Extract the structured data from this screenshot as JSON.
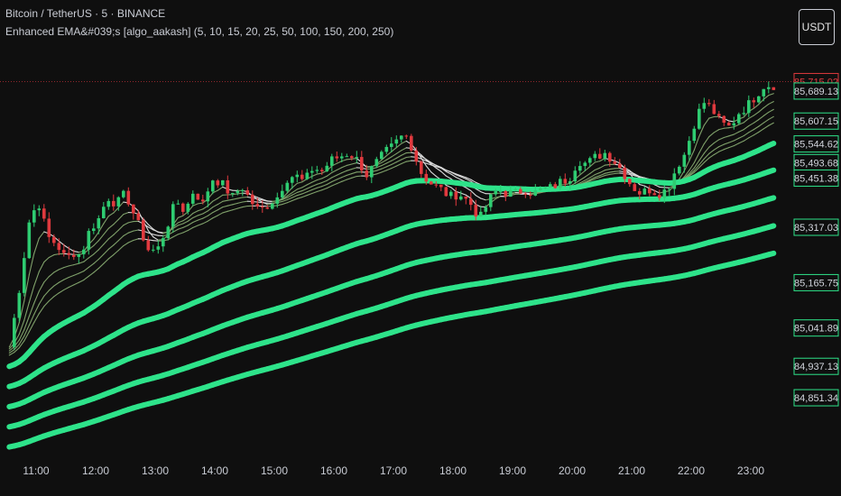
{
  "header": {
    "symbol": "Bitcoin / TetherUS · 5 · BINANCE",
    "indicator": "Enhanced EMA&#039;s [algo_aakash] (5, 10, 15, 20, 25, 50, 100, 150, 200, 250)"
  },
  "unit_button": "USDT",
  "colors": {
    "background": "#0f0f0f",
    "up": "#2ecc71",
    "down": "#e0393e",
    "ema_long": "#2ee38a",
    "ema_short": "#7fa06a",
    "ema_short_bearish": "#d9d9d9",
    "last_price": "#e0393e",
    "price_tag": "#2ee38a"
  },
  "chart_data": {
    "type": "candlestick",
    "x_labels": [
      "11:00",
      "12:00",
      "13:00",
      "14:00",
      "15:00",
      "16:00",
      "17:00",
      "18:00",
      "19:00",
      "20:00",
      "21:00",
      "22:00",
      "23:00"
    ],
    "ylim": [
      84780,
      85790
    ],
    "last_price": {
      "label": "85,715.02",
      "value": 85715.02
    },
    "price_tags": [
      {
        "label": "85,689.13",
        "value": 85689.13
      },
      {
        "label": "85,607.15",
        "value": 85607.15
      },
      {
        "label": "85,544.62",
        "value": 85544.62
      },
      {
        "label": "85,493.68",
        "value": 85493.68
      },
      {
        "label": "85,451.38",
        "value": 85451.38
      },
      {
        "label": "85,317.03",
        "value": 85317.03
      },
      {
        "label": "85,165.75",
        "value": 85165.75
      },
      {
        "label": "85,041.89",
        "value": 85041.89
      },
      {
        "label": "84,937.13",
        "value": 84937.13
      },
      {
        "label": "84,851.34",
        "value": 84851.34
      }
    ],
    "close_path": [
      [
        10.55,
        84990
      ],
      [
        10.7,
        85130
      ],
      [
        10.9,
        85350
      ],
      [
        11.05,
        85380
      ],
      [
        11.2,
        85290
      ],
      [
        11.35,
        85270
      ],
      [
        11.5,
        85230
      ],
      [
        11.65,
        85250
      ],
      [
        11.75,
        85240
      ],
      [
        11.9,
        85310
      ],
      [
        12.05,
        85340
      ],
      [
        12.2,
        85400
      ],
      [
        12.35,
        85380
      ],
      [
        12.5,
        85410
      ],
      [
        12.7,
        85330
      ],
      [
        12.9,
        85250
      ],
      [
        13.05,
        85260
      ],
      [
        13.2,
        85320
      ],
      [
        13.35,
        85390
      ],
      [
        13.5,
        85360
      ],
      [
        13.65,
        85420
      ],
      [
        13.8,
        85380
      ],
      [
        13.95,
        85450
      ],
      [
        14.1,
        85440
      ],
      [
        14.3,
        85400
      ],
      [
        14.45,
        85430
      ],
      [
        14.6,
        85390
      ],
      [
        14.75,
        85360
      ],
      [
        14.9,
        85380
      ],
      [
        15.05,
        85400
      ],
      [
        15.2,
        85450
      ],
      [
        15.35,
        85460
      ],
      [
        15.5,
        85440
      ],
      [
        15.65,
        85480
      ],
      [
        15.8,
        85470
      ],
      [
        15.95,
        85500
      ],
      [
        16.1,
        85510
      ],
      [
        16.25,
        85520
      ],
      [
        16.4,
        85500
      ],
      [
        16.55,
        85460
      ],
      [
        16.7,
        85490
      ],
      [
        16.85,
        85520
      ],
      [
        17.0,
        85540
      ],
      [
        17.1,
        85560
      ],
      [
        17.2,
        85570
      ],
      [
        17.3,
        85540
      ],
      [
        17.45,
        85470
      ],
      [
        17.6,
        85440
      ],
      [
        17.8,
        85420
      ],
      [
        17.95,
        85400
      ],
      [
        18.1,
        85410
      ],
      [
        18.3,
        85380
      ],
      [
        18.45,
        85340
      ],
      [
        18.6,
        85390
      ],
      [
        18.75,
        85420
      ],
      [
        18.9,
        85410
      ],
      [
        19.05,
        85410
      ],
      [
        19.2,
        85420
      ],
      [
        19.35,
        85410
      ],
      [
        19.5,
        85420
      ],
      [
        19.65,
        85425
      ],
      [
        19.8,
        85440
      ],
      [
        19.95,
        85450
      ],
      [
        20.1,
        85500
      ],
      [
        20.25,
        85490
      ],
      [
        20.4,
        85510
      ],
      [
        20.55,
        85520
      ],
      [
        20.7,
        85500
      ],
      [
        20.85,
        85470
      ],
      [
        21.0,
        85430
      ],
      [
        21.15,
        85410
      ],
      [
        21.3,
        85420
      ],
      [
        21.45,
        85410
      ],
      [
        21.6,
        85420
      ],
      [
        21.75,
        85480
      ],
      [
        21.9,
        85520
      ],
      [
        22.05,
        85600
      ],
      [
        22.2,
        85660
      ],
      [
        22.35,
        85640
      ],
      [
        22.5,
        85600
      ],
      [
        22.65,
        85590
      ],
      [
        22.8,
        85630
      ],
      [
        22.95,
        85650
      ],
      [
        23.1,
        85680
      ],
      [
        23.25,
        85710
      ],
      [
        23.35,
        85700
      ],
      [
        23.45,
        85715.02
      ]
    ],
    "ema_periods": [
      5,
      10,
      15,
      20,
      25,
      50,
      100,
      150,
      200,
      250
    ]
  }
}
